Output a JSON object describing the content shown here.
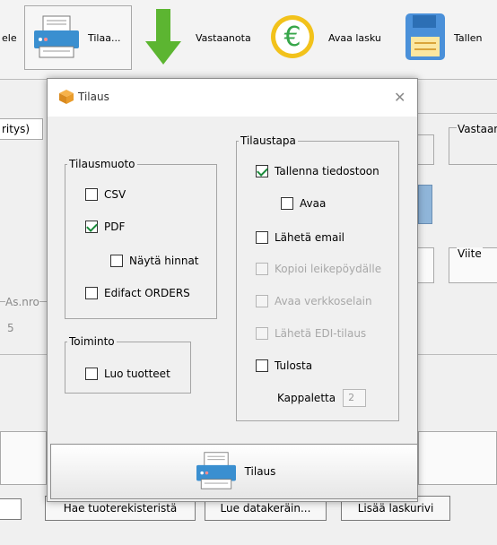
{
  "toolbar": {
    "partial_left_label": "ele",
    "order_label": "Tilaa...",
    "receive_label": "Vastaanota",
    "open_invoice_label": "Avaa lasku",
    "save_label": "Tallen"
  },
  "background": {
    "partial_tab": "ritys)",
    "receiver_label": "Vastaan",
    "reference_label": "Viite",
    "customer_no_label": "As.nro",
    "customer_no_value": "5",
    "buttons": {
      "fetch_catalog": "Hae tuoterekisteristä",
      "read_collector": "Lue datakeräin...",
      "add_row": "Lisää laskurivi"
    }
  },
  "dialog": {
    "title": "Tilaus",
    "format_group": {
      "legend": "Tilausmuoto",
      "options": [
        {
          "label": "CSV",
          "checked": false
        },
        {
          "label": "PDF",
          "checked": true
        },
        {
          "label": "Näytä hinnat",
          "checked": false
        },
        {
          "label": "Edifact ORDERS",
          "checked": false
        }
      ]
    },
    "action_group": {
      "legend": "Toiminto",
      "options": [
        {
          "label": "Luo tuotteet",
          "checked": false
        }
      ]
    },
    "method_group": {
      "legend": "Tilaustapa",
      "options": [
        {
          "label": "Tallenna tiedostoon",
          "checked": true,
          "enabled": true
        },
        {
          "label": "Avaa",
          "checked": false,
          "enabled": true
        },
        {
          "label": "Lähetä email",
          "checked": false,
          "enabled": true
        },
        {
          "label": "Kopioi leikepöydälle",
          "checked": false,
          "enabled": false
        },
        {
          "label": "Avaa verkkoselain",
          "checked": false,
          "enabled": false
        },
        {
          "label": "Lähetä EDI-tilaus",
          "checked": false,
          "enabled": false
        },
        {
          "label": "Tulosta",
          "checked": false,
          "enabled": true
        }
      ],
      "copies_label": "Kappaletta",
      "copies_value": "2"
    },
    "order_button_label": "Tilaus"
  },
  "colors": {
    "check": "#1a8a3a",
    "printer_blue": "#3a8fd0",
    "receive_green": "#5cb531",
    "euro_yellow": "#f2c21b",
    "save_blue": "#4a90d9"
  },
  "icons": [
    "printer-icon",
    "down-arrow-icon",
    "euro-coin-icon",
    "save-icon",
    "package-icon",
    "close-icon"
  ]
}
